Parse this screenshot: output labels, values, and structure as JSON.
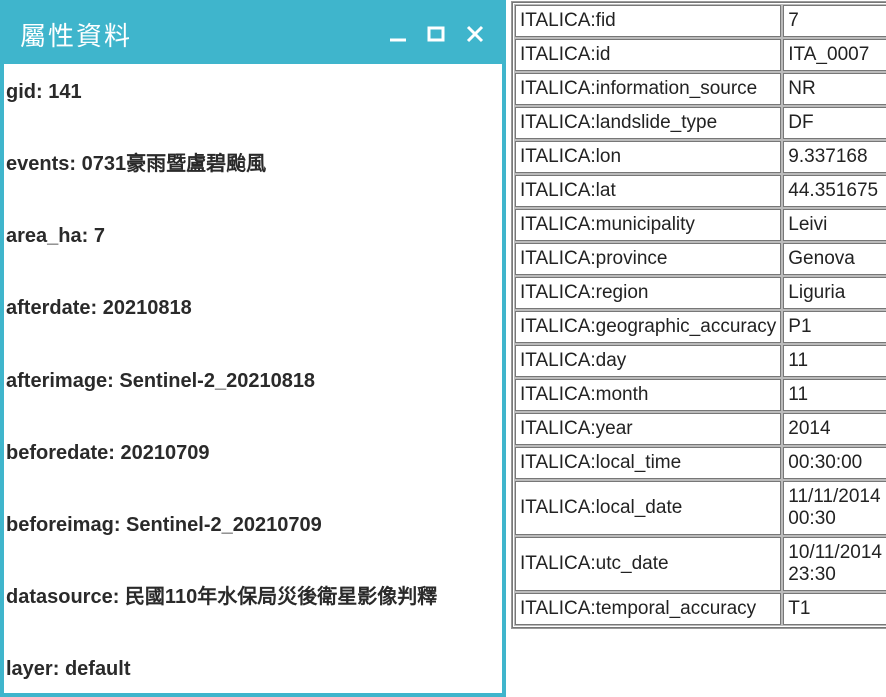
{
  "left": {
    "title": "屬性資料",
    "fields": [
      {
        "key": "gid",
        "value": "141"
      },
      {
        "key": "events",
        "value": "0731豪雨暨盧碧颱風"
      },
      {
        "key": "area_ha",
        "value": "7"
      },
      {
        "key": "afterdate",
        "value": "20210818"
      },
      {
        "key": "afterimage",
        "value": "Sentinel-2_20210818"
      },
      {
        "key": "beforedate",
        "value": "20210709"
      },
      {
        "key": "beforeimag",
        "value": "Sentinel-2_20210709"
      },
      {
        "key": "datasource",
        "value": "民國110年水保局災後衛星影像判釋"
      },
      {
        "key": "layer",
        "value": "default"
      }
    ]
  },
  "right": {
    "rows": [
      {
        "key": "ITALICA:fid",
        "value": "7"
      },
      {
        "key": "ITALICA:id",
        "value": "ITA_0007"
      },
      {
        "key": "ITALICA:information_source",
        "value": "NR"
      },
      {
        "key": "ITALICA:landslide_type",
        "value": "DF"
      },
      {
        "key": "ITALICA:lon",
        "value": "9.337168"
      },
      {
        "key": "ITALICA:lat",
        "value": "44.351675"
      },
      {
        "key": "ITALICA:municipality",
        "value": "Leivi"
      },
      {
        "key": "ITALICA:province",
        "value": "Genova"
      },
      {
        "key": "ITALICA:region",
        "value": "Liguria"
      },
      {
        "key": "ITALICA:geographic_accuracy",
        "value": "P1"
      },
      {
        "key": "ITALICA:day",
        "value": "11"
      },
      {
        "key": "ITALICA:month",
        "value": "11"
      },
      {
        "key": "ITALICA:year",
        "value": "2014"
      },
      {
        "key": "ITALICA:local_time",
        "value": "00:30:00"
      },
      {
        "key": "ITALICA:local_date",
        "value": "11/11/2014 00:30"
      },
      {
        "key": "ITALICA:utc_date",
        "value": "10/11/2014 23:30"
      },
      {
        "key": "ITALICA:temporal_accuracy",
        "value": "T1"
      }
    ]
  }
}
